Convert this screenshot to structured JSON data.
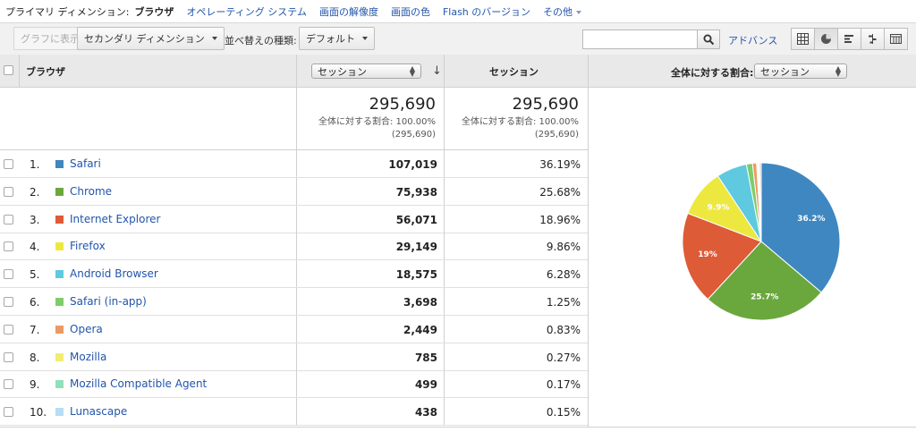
{
  "dimension_bar": {
    "label": "プライマリ ディメンション:",
    "current": "ブラウザ",
    "links": [
      "オペレーティング システム",
      "画面の解像度",
      "画面の色",
      "Flash のバージョン"
    ],
    "more": "その他"
  },
  "toolbar": {
    "graph_button": "グラフに表示",
    "secondary_dimension": "セカンダリ ディメンション",
    "sort_label": "並べ替えの種類:",
    "sort_value": "デフォルト",
    "search_value": "",
    "advanced": "アドバンス",
    "view_icons": [
      "table-view-icon",
      "pie-view-icon",
      "bar-view-icon",
      "comparison-view-icon",
      "pivot-view-icon"
    ]
  },
  "table": {
    "header_dimension": "ブラウザ",
    "header_metric_select": "セッション",
    "header_metric2": "セッション",
    "totals": {
      "sessions": "295,690",
      "sessions_share": "全体に対する割合: 100.00%",
      "sessions_share_abs": "(295,690)",
      "metric2": "295,690",
      "metric2_share": "全体に対する割合: 100.00%",
      "metric2_share_abs": "(295,690)"
    },
    "rows": [
      {
        "num": "1.",
        "name": "Safari",
        "sessions": "107,019",
        "pct": "36.19%",
        "color": "#3f87c0"
      },
      {
        "num": "2.",
        "name": "Chrome",
        "sessions": "75,938",
        "pct": "25.68%",
        "color": "#6aa83e"
      },
      {
        "num": "3.",
        "name": "Internet Explorer",
        "sessions": "56,071",
        "pct": "18.96%",
        "color": "#dd5b37"
      },
      {
        "num": "4.",
        "name": "Firefox",
        "sessions": "29,149",
        "pct": "9.86%",
        "color": "#ede83f"
      },
      {
        "num": "5.",
        "name": "Android Browser",
        "sessions": "18,575",
        "pct": "6.28%",
        "color": "#5ec9df"
      },
      {
        "num": "6.",
        "name": "Safari (in-app)",
        "sessions": "3,698",
        "pct": "1.25%",
        "color": "#7dcd6b"
      },
      {
        "num": "7.",
        "name": "Opera",
        "sessions": "2,449",
        "pct": "0.83%",
        "color": "#ec9a63"
      },
      {
        "num": "8.",
        "name": "Mozilla",
        "sessions": "785",
        "pct": "0.27%",
        "color": "#f2ec74"
      },
      {
        "num": "9.",
        "name": "Mozilla Compatible Agent",
        "sessions": "499",
        "pct": "0.17%",
        "color": "#8fe0bd"
      },
      {
        "num": "10.",
        "name": "Lunascape",
        "sessions": "438",
        "pct": "0.15%",
        "color": "#b7dcf4"
      }
    ]
  },
  "chart_header": {
    "label": "全体に対する割合:",
    "select_value": "セッション"
  },
  "chart_data": {
    "type": "pie",
    "categories": [
      "Safari",
      "Chrome",
      "Internet Explorer",
      "Firefox",
      "Android Browser",
      "Safari (in-app)",
      "Opera",
      "Mozilla",
      "Mozilla Compatible Agent",
      "Lunascape",
      "その他"
    ],
    "values": [
      36.19,
      25.68,
      18.96,
      9.86,
      6.28,
      1.25,
      0.83,
      0.27,
      0.17,
      0.15,
      0.36
    ],
    "colors": [
      "#3f87c0",
      "#6aa83e",
      "#dd5b37",
      "#ede83f",
      "#5ec9df",
      "#7dcd6b",
      "#ec9a63",
      "#f2ec74",
      "#8fe0bd",
      "#b7dcf4",
      "#c9c9c9"
    ],
    "slice_labels": [
      "36.2%",
      "25.7%",
      "19%",
      "9.9%",
      "",
      "",
      "",
      "",
      "",
      "",
      ""
    ]
  }
}
